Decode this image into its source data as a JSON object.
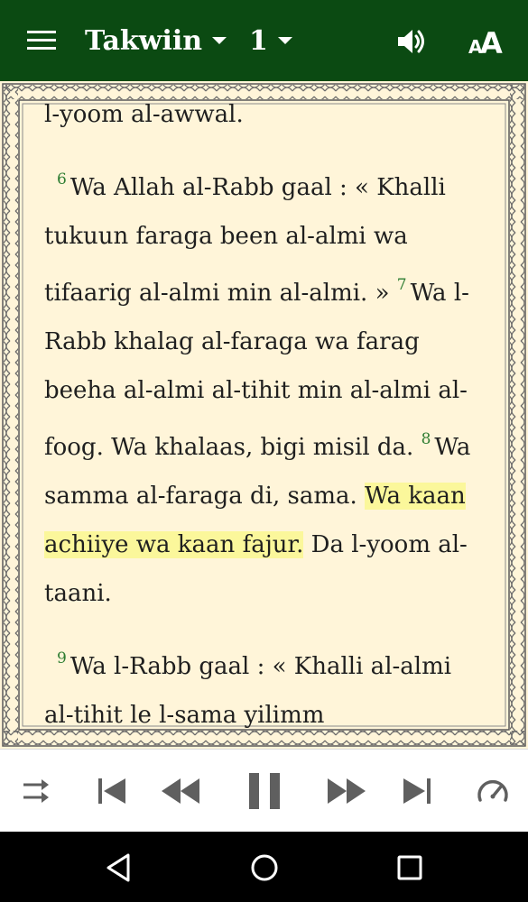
{
  "header": {
    "book_label": "Takwiin",
    "chapter_label": "1",
    "icons": {
      "menu": "menu-icon",
      "book_dropdown": "chevron-down-icon",
      "chapter_dropdown": "chevron-down-icon",
      "audio": "speaker-icon",
      "font": "text-size-icon"
    },
    "font_icon_text": "AA"
  },
  "colors": {
    "header_bg": "#0b4a12",
    "page_bg": "#fff5d9",
    "verse_number": "#2e7d32",
    "highlight": "#fbf79b"
  },
  "reading": {
    "p1": {
      "t1": "l-yoom al-awwal."
    },
    "p2": {
      "v6": "6",
      "t6": "Wa Allah al-Rabb gaal : « Khalli tukuun faraga been al-almi wa tifaarig al-almi min al-almi. » ",
      "v7": "7",
      "t7": "Wa l-Rabb khalag al-faraga wa farag beeha al-almi al-tihit min al-almi al-foog. Wa khalaas, bigi misil da. ",
      "v8": "8",
      "t8a": "Wa samma al-faraga di, sama. ",
      "t8hl": "Wa kaan achiiye wa kaan fajur.",
      "t8b": " Da l-yoom al-taani."
    },
    "p3": {
      "v9": "9",
      "t9": "Wa l-Rabb gaal : « Khalli al-almi al-tihit le l-sama yilimm"
    }
  },
  "player": {
    "icons": [
      "repeat-mode-icon",
      "skip-previous-icon",
      "rewind-icon",
      "pause-icon",
      "fast-forward-icon",
      "skip-next-icon",
      "playback-speed-icon"
    ]
  },
  "system_nav": {
    "icons": [
      "back-icon",
      "home-icon",
      "recents-icon"
    ]
  }
}
